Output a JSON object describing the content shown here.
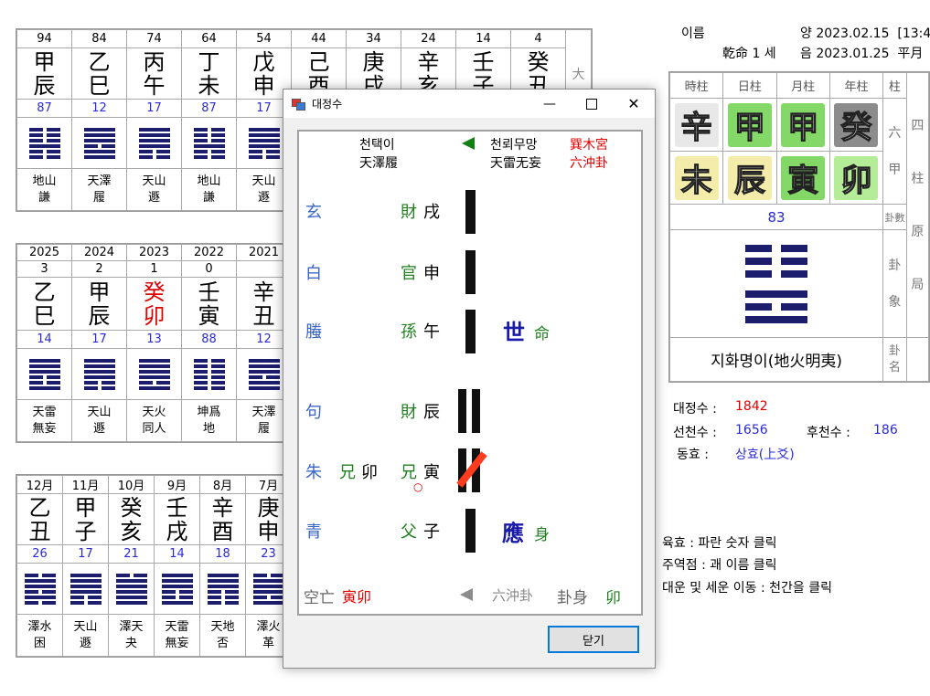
{
  "daewoon": {
    "ages": [
      "94",
      "84",
      "74",
      "64",
      "54",
      "44",
      "34",
      "24",
      "14",
      "4"
    ],
    "stems": [
      "甲",
      "乙",
      "丙",
      "丁",
      "戊",
      "己",
      "庚",
      "辛",
      "壬",
      "癸"
    ],
    "branches": [
      "辰",
      "巳",
      "午",
      "未",
      "申",
      "酉",
      "戌",
      "亥",
      "子",
      "丑"
    ],
    "nums": [
      "87",
      "12",
      "17",
      "87",
      "17"
    ],
    "hexagrams": [
      {
        "n1": "地山",
        "n2": "謙",
        "lines": [
          0,
          0,
          0,
          1,
          0,
          0
        ]
      },
      {
        "n1": "天澤",
        "n2": "履",
        "lines": [
          1,
          1,
          1,
          0,
          1,
          1
        ]
      },
      {
        "n1": "天山",
        "n2": "遯",
        "lines": [
          1,
          1,
          1,
          1,
          0,
          0
        ]
      },
      {
        "n1": "地山",
        "n2": "謙",
        "lines": [
          0,
          0,
          0,
          1,
          0,
          0
        ]
      },
      {
        "n1": "天山",
        "n2": "遯",
        "lines": [
          1,
          1,
          1,
          1,
          0,
          0
        ]
      }
    ],
    "extra_label": "大"
  },
  "sewoon": {
    "years": [
      "2025",
      "2024",
      "2023",
      "2022",
      "2021"
    ],
    "ages": [
      "3",
      "2",
      "1",
      "0",
      ""
    ],
    "stems": [
      "乙",
      "甲",
      "癸",
      "壬",
      "辛"
    ],
    "branches": [
      "巳",
      "辰",
      "卯",
      "寅",
      "丑"
    ],
    "nums": [
      "14",
      "17",
      "13",
      "88",
      "12"
    ],
    "hexagrams": [
      {
        "n1": "天雷",
        "n2": "無妄",
        "lines": [
          1,
          1,
          1,
          0,
          0,
          1
        ]
      },
      {
        "n1": "天山",
        "n2": "遯",
        "lines": [
          1,
          1,
          1,
          1,
          0,
          0
        ]
      },
      {
        "n1": "天火",
        "n2": "同人",
        "lines": [
          1,
          1,
          1,
          1,
          0,
          1
        ]
      },
      {
        "n1": "坤爲",
        "n2": "地",
        "lines": [
          0,
          0,
          0,
          0,
          0,
          0
        ]
      },
      {
        "n1": "天澤",
        "n2": "履",
        "lines": [
          1,
          1,
          1,
          0,
          1,
          1
        ]
      }
    ]
  },
  "wolwoon": {
    "months": [
      "12月",
      "11月",
      "10月",
      "9月",
      "8月",
      "7月"
    ],
    "stems": [
      "乙",
      "甲",
      "癸",
      "壬",
      "辛",
      "庚"
    ],
    "branches": [
      "丑",
      "子",
      "亥",
      "戌",
      "酉",
      "申"
    ],
    "nums": [
      "26",
      "17",
      "21",
      "14",
      "18",
      "23"
    ],
    "hexagrams": [
      {
        "n1": "澤水",
        "n2": "困",
        "lines": [
          0,
          1,
          1,
          0,
          1,
          0
        ]
      },
      {
        "n1": "天山",
        "n2": "遯",
        "lines": [
          1,
          1,
          1,
          1,
          0,
          0
        ]
      },
      {
        "n1": "澤天",
        "n2": "夬",
        "lines": [
          0,
          1,
          1,
          1,
          1,
          1
        ]
      },
      {
        "n1": "天雷",
        "n2": "無妄",
        "lines": [
          1,
          1,
          1,
          0,
          0,
          1
        ]
      },
      {
        "n1": "天地",
        "n2": "否",
        "lines": [
          1,
          1,
          1,
          0,
          0,
          0
        ]
      },
      {
        "n1": "澤火",
        "n2": "革",
        "lines": [
          0,
          1,
          1,
          1,
          0,
          1
        ]
      }
    ]
  },
  "info": {
    "name_label": "이름",
    "solar": "양 2023.02.15  [13:4",
    "gun": "乾命 1 세",
    "lunar": "음 2023.01.25  平月"
  },
  "pillars": {
    "headers": [
      "時柱",
      "日柱",
      "月柱",
      "年柱",
      "柱"
    ],
    "stems": [
      {
        "ch": "辛",
        "bg": "#e8e8e8"
      },
      {
        "ch": "甲",
        "bg": "#84d868"
      },
      {
        "ch": "甲",
        "bg": "#84d868"
      },
      {
        "ch": "癸",
        "bg": "#8c8c8c"
      }
    ],
    "branches": [
      {
        "ch": "未",
        "bg": "#f4ecaa"
      },
      {
        "ch": "辰",
        "bg": "#f4ecaa"
      },
      {
        "ch": "寅",
        "bg": "#84d868"
      },
      {
        "ch": "卯",
        "bg": "#b4ec98"
      }
    ],
    "side_labels": [
      "六",
      "甲"
    ],
    "far_side": [
      "四",
      "柱",
      "原",
      "局"
    ],
    "gua_num_label": "卦數",
    "gua_num": "83",
    "gua_xiang_label": [
      "卦",
      "象"
    ],
    "gua_name_label": [
      "卦",
      "名"
    ],
    "gua_name": "지화명이(地火明夷)",
    "gua_lines": [
      0,
      0,
      0,
      1,
      0,
      1
    ]
  },
  "stats": {
    "dj_label": "대정수 :",
    "dj_value": "1842",
    "sc_label": "선천수 :",
    "sc_value": "1656",
    "hc_label": "후천수 :",
    "hc_value": "186",
    "dh_label": "동효 :",
    "dh_value": "상효(上爻)"
  },
  "help": [
    "육효 : 파란 숫자 클릭",
    "주역점 : 괘 이름 클릭",
    "대운 및 세운 이동 : 천간을 클릭"
  ],
  "dialog": {
    "title": "대정수",
    "gua_left_kr": "천택이",
    "gua_left_hz": "天澤履",
    "gua_right_kr": "천뢰무망",
    "gua_right_hz": "天雷无妄",
    "palace": "巽木宮",
    "chong": "六沖卦",
    "spirits": [
      "玄",
      "白",
      "螣",
      "句",
      "朱",
      "青"
    ],
    "relations": [
      {
        "rel": "財",
        "br": "戌"
      },
      {
        "rel": "官",
        "br": "申"
      },
      {
        "rel": "孫",
        "br": "午"
      },
      {
        "rel": "財",
        "br": "辰"
      },
      {
        "rel": "兄",
        "br": "寅"
      },
      {
        "rel": "父",
        "br": "子"
      }
    ],
    "hidden_rel": "兄",
    "hidden_br": "卯",
    "circle_mark": "○",
    "shi": "世",
    "shi_sub": "命",
    "ying": "應",
    "ying_sub": "身",
    "kongwang_label": "空亡",
    "kongwang_value": "寅卯",
    "bottom_chong": "六沖卦",
    "guashen_label": "卦身",
    "guashen_value": "卯",
    "close_label": "닫기",
    "colors": {
      "line": "#111111",
      "moving": "#ff3c1e",
      "spirit": "#3a66c8",
      "relation": "#208020",
      "shiying": "#1a1aa8"
    }
  }
}
